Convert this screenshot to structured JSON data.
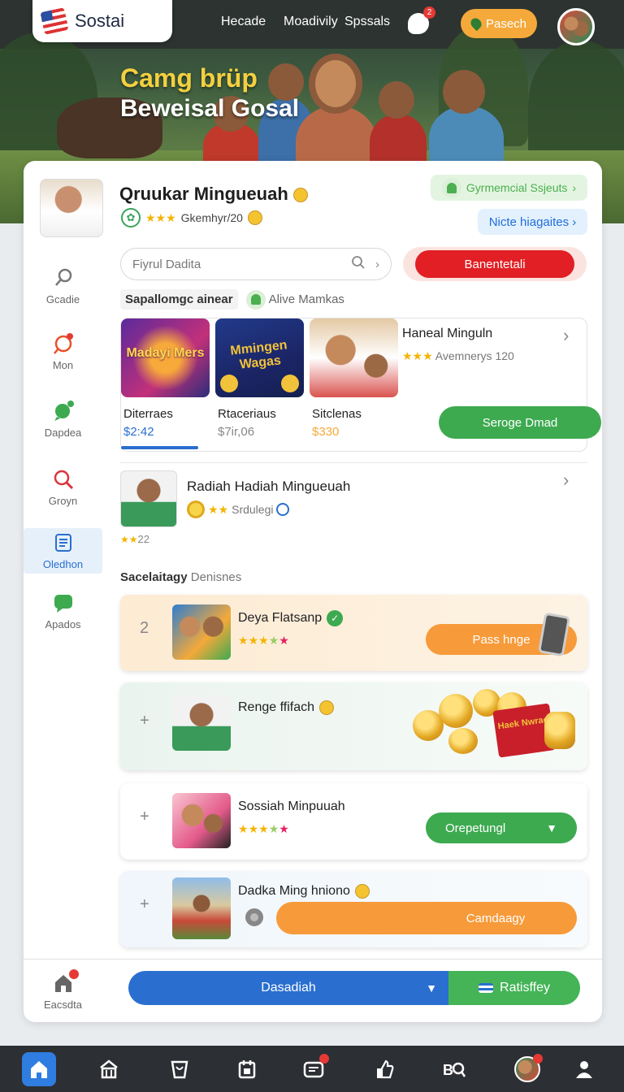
{
  "header": {
    "logo_text": "Sostai",
    "nav": [
      "Hecade",
      "Moadivily",
      "Spssals"
    ],
    "notification_count": "2",
    "cta_label": "Pasech",
    "hero_title_1": "Camg brüp",
    "hero_title_2": "Beweisal Gosal"
  },
  "profile": {
    "name": "Qruukar Mingueuah",
    "meta": "Gkemhyr/20",
    "chip_green": "Gyrmemcial Ssjeuts",
    "chip_blue": "Nicte hiagaites"
  },
  "sidebar": {
    "items": [
      {
        "label": "Gcadie",
        "icon": "search-icon"
      },
      {
        "label": "Mon",
        "icon": "map-pin-icon"
      },
      {
        "label": "Dapdea",
        "icon": "chat-icon"
      },
      {
        "label": "Groyn",
        "icon": "magnifier-icon"
      },
      {
        "label": "Oledhon",
        "icon": "list-icon"
      },
      {
        "label": "Apados",
        "icon": "message-icon"
      }
    ],
    "footer_label": "Eacsdta"
  },
  "search": {
    "placeholder": "Fiyrul Dadita",
    "red_button": "Banentetali"
  },
  "subhead": {
    "bold": "Sapallomgc ainear",
    "light": "Alive Mamkas"
  },
  "games": {
    "items": [
      {
        "label": "Diterraes",
        "price": "$2:42",
        "price_color": "#2a6fd0",
        "art": "Madayi Mers"
      },
      {
        "label": "Rtaceriaus",
        "price": "$7ir,06",
        "price_color": "#888888",
        "art": "Mmingen Wagas"
      },
      {
        "label": "Sitclenas",
        "price": "$330",
        "price_color": "#f4a93a",
        "art": ""
      }
    ],
    "right_title": "Haneal Minguln",
    "right_meta": "Avemnerys 120",
    "right_button": "Seroge Dmad"
  },
  "featured": {
    "title": "Radiah Hadiah Mingueuah",
    "meta": "Srdulegi",
    "small": "22"
  },
  "section": {
    "bold": "Sacelaitagy",
    "light": "Denisnes"
  },
  "list": [
    {
      "num": "2",
      "title": "Deya Flatsanp",
      "button": "Pass hnge"
    },
    {
      "num": "+",
      "title": "Renge ffifach"
    },
    {
      "num": "+",
      "title": "Sossiah Minpuuah",
      "button": "Orepetungl"
    },
    {
      "num": "+",
      "title": "Dadka Ming hniono",
      "button": "Camdaagy"
    }
  ],
  "coins_card_text": "Haek Nwrac",
  "footer": {
    "left_button": "Dasadiah",
    "right_button": "Ratisffey"
  },
  "colors": {
    "primary": "#2a6fd0",
    "green": "#3daa50",
    "orange": "#f79a3a",
    "red": "#e11f24"
  }
}
